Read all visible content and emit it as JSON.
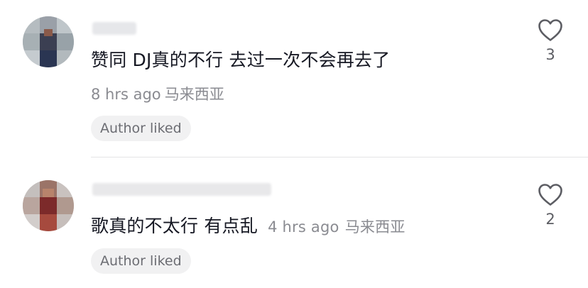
{
  "comments": [
    {
      "text": "赞同 DJ真的不行 去过一次不会再去了",
      "time": "8 hrs ago",
      "location": "马来西亚",
      "badge": "Author liked",
      "likes": "3",
      "username_redacted": true,
      "avatar_icon": "pixelated-avatar"
    },
    {
      "text": "歌真的不太行 有点乱",
      "time": "4 hrs ago",
      "location": "马来西亚",
      "badge": "Author liked",
      "likes": "2",
      "username_redacted": true,
      "avatar_icon": "pixelated-avatar"
    }
  ],
  "icons": {
    "like": "heart-outline-icon"
  },
  "colors": {
    "text": "#161823",
    "meta": "#8a8b91",
    "badge_bg": "#f1f1f2",
    "divider": "#e4e4e6"
  }
}
